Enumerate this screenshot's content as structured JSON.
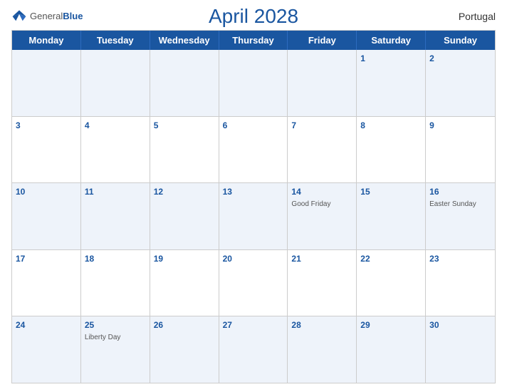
{
  "header": {
    "logo": {
      "general": "General",
      "blue": "Blue"
    },
    "title": "April 2028",
    "country": "Portugal"
  },
  "calendar": {
    "days_of_week": [
      "Monday",
      "Tuesday",
      "Wednesday",
      "Thursday",
      "Friday",
      "Saturday",
      "Sunday"
    ],
    "weeks": [
      [
        {
          "day": "",
          "event": ""
        },
        {
          "day": "",
          "event": ""
        },
        {
          "day": "",
          "event": ""
        },
        {
          "day": "",
          "event": ""
        },
        {
          "day": "",
          "event": ""
        },
        {
          "day": "1",
          "event": ""
        },
        {
          "day": "2",
          "event": ""
        }
      ],
      [
        {
          "day": "3",
          "event": ""
        },
        {
          "day": "4",
          "event": ""
        },
        {
          "day": "5",
          "event": ""
        },
        {
          "day": "6",
          "event": ""
        },
        {
          "day": "7",
          "event": ""
        },
        {
          "day": "8",
          "event": ""
        },
        {
          "day": "9",
          "event": ""
        }
      ],
      [
        {
          "day": "10",
          "event": ""
        },
        {
          "day": "11",
          "event": ""
        },
        {
          "day": "12",
          "event": ""
        },
        {
          "day": "13",
          "event": ""
        },
        {
          "day": "14",
          "event": "Good Friday"
        },
        {
          "day": "15",
          "event": ""
        },
        {
          "day": "16",
          "event": "Easter Sunday"
        }
      ],
      [
        {
          "day": "17",
          "event": ""
        },
        {
          "day": "18",
          "event": ""
        },
        {
          "day": "19",
          "event": ""
        },
        {
          "day": "20",
          "event": ""
        },
        {
          "day": "21",
          "event": ""
        },
        {
          "day": "22",
          "event": ""
        },
        {
          "day": "23",
          "event": ""
        }
      ],
      [
        {
          "day": "24",
          "event": ""
        },
        {
          "day": "25",
          "event": "Liberty Day"
        },
        {
          "day": "26",
          "event": ""
        },
        {
          "day": "27",
          "event": ""
        },
        {
          "day": "28",
          "event": ""
        },
        {
          "day": "29",
          "event": ""
        },
        {
          "day": "30",
          "event": ""
        }
      ]
    ]
  }
}
